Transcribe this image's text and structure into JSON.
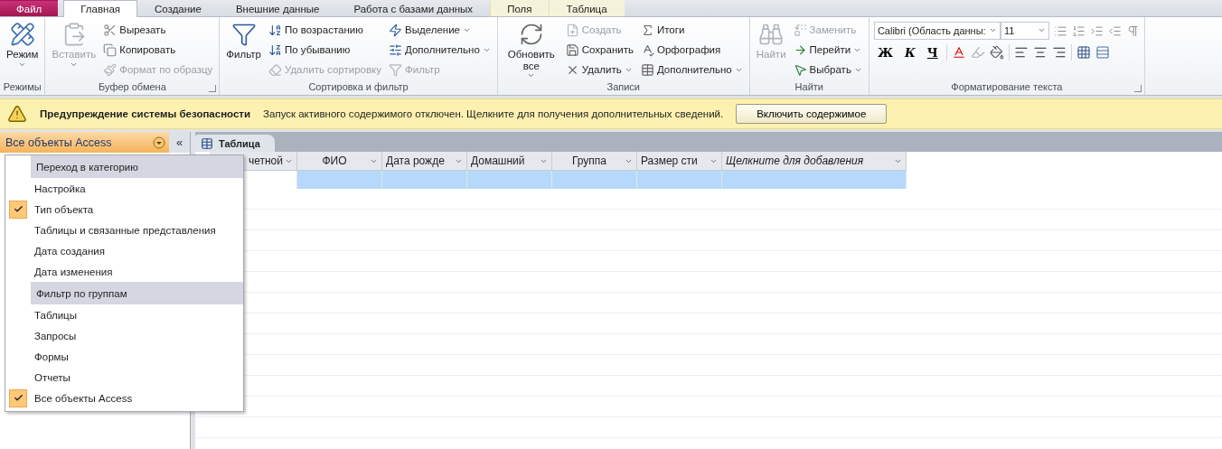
{
  "tabs": [
    {
      "label": "Файл",
      "kind": "file",
      "selected": false
    },
    {
      "label": "Главная",
      "kind": "normal",
      "selected": true
    },
    {
      "label": "Создание",
      "kind": "normal",
      "selected": false
    },
    {
      "label": "Внешние данные",
      "kind": "normal",
      "selected": false
    },
    {
      "label": "Работа с базами данных",
      "kind": "normal",
      "selected": false
    },
    {
      "label": "Поля",
      "kind": "context",
      "selected": false
    },
    {
      "label": "Таблица",
      "kind": "context",
      "selected": false
    }
  ],
  "ribbon": {
    "groups": [
      {
        "label": "Режимы",
        "launcher": false,
        "columns": [
          {
            "kind": "large",
            "label": "Режим",
            "disabled": false,
            "dropdown": true
          }
        ]
      },
      {
        "label": "Буфер обмена",
        "launcher": true,
        "columns": [
          {
            "kind": "large",
            "label": "Вставить",
            "disabled": true,
            "dropdown": true
          },
          {
            "kind": "stack",
            "items": [
              {
                "label": "Вырезать",
                "disabled": false,
                "dropdown": false
              },
              {
                "label": "Копировать",
                "disabled": false,
                "dropdown": false
              },
              {
                "label": "Формат по образцу",
                "disabled": true,
                "dropdown": false
              }
            ]
          }
        ]
      },
      {
        "label": "Сортировка и фильтр",
        "launcher": false,
        "columns": [
          {
            "kind": "large",
            "label": "Фильтр",
            "disabled": false,
            "dropdown": false
          },
          {
            "kind": "stack",
            "items": [
              {
                "label": "По возрастанию",
                "disabled": false,
                "dropdown": false
              },
              {
                "label": "По убыванию",
                "disabled": false,
                "dropdown": false
              },
              {
                "label": "Удалить сортировку",
                "disabled": true,
                "dropdown": false
              }
            ]
          },
          {
            "kind": "stack",
            "items": [
              {
                "label": "Выделение",
                "disabled": false,
                "dropdown": true
              },
              {
                "label": "Дополнительно",
                "disabled": false,
                "dropdown": true
              },
              {
                "label": "Фильтр",
                "disabled": true,
                "dropdown": false
              }
            ]
          }
        ]
      },
      {
        "label": "Записи",
        "launcher": false,
        "columns": [
          {
            "kind": "large",
            "label": "Обновить все",
            "disabled": false,
            "dropdown": true
          },
          {
            "kind": "stack",
            "items": [
              {
                "label": "Создать",
                "disabled": true,
                "dropdown": false
              },
              {
                "label": "Сохранить",
                "disabled": false,
                "dropdown": false
              },
              {
                "label": "Удалить",
                "disabled": false,
                "dropdown": true
              }
            ]
          },
          {
            "kind": "stack",
            "items": [
              {
                "label": "Итоги",
                "disabled": false,
                "dropdown": false
              },
              {
                "label": "Орфография",
                "disabled": false,
                "dropdown": false
              },
              {
                "label": "Дополнительно",
                "disabled": false,
                "dropdown": true
              }
            ]
          }
        ]
      },
      {
        "label": "Найти",
        "launcher": false,
        "columns": [
          {
            "kind": "large",
            "label": "Найти",
            "disabled": true,
            "dropdown": false
          },
          {
            "kind": "stack",
            "items": [
              {
                "label": "Заменить",
                "disabled": true,
                "dropdown": false
              },
              {
                "label": "Перейти",
                "disabled": false,
                "dropdown": true
              },
              {
                "label": "Выбрать",
                "disabled": false,
                "dropdown": true
              }
            ]
          }
        ]
      },
      {
        "label": "Форматирование текста",
        "launcher": true,
        "columns": [
          {
            "kind": "format",
            "font": "Calibri (Область данны:",
            "size": "11",
            "styles": [
              "Ж",
              "К",
              "Ч"
            ]
          }
        ]
      }
    ]
  },
  "security_bar": {
    "title": "Предупреждение системы безопасности",
    "message": "Запуск активного содержимого отключен. Щелкните для получения дополнительных сведений.",
    "button": "Включить содержимое"
  },
  "nav_pane": {
    "title": "Все объекты Access",
    "collapse": "«",
    "menu": [
      {
        "kind": "header",
        "label": "Переход в категорию"
      },
      {
        "kind": "item",
        "label": "Настройка",
        "checked": false
      },
      {
        "kind": "item",
        "label": "Тип объекта",
        "checked": true
      },
      {
        "kind": "item",
        "label": "Таблицы и связанные представления",
        "checked": false
      },
      {
        "kind": "item",
        "label": "Дата создания",
        "checked": false
      },
      {
        "kind": "item",
        "label": "Дата изменения",
        "checked": false
      },
      {
        "kind": "header",
        "label": "Фильтр по группам"
      },
      {
        "kind": "item",
        "label": "Таблицы",
        "checked": false
      },
      {
        "kind": "item",
        "label": "Запросы",
        "checked": false
      },
      {
        "kind": "item",
        "label": "Формы",
        "checked": false
      },
      {
        "kind": "item",
        "label": "Отчеты",
        "checked": false
      },
      {
        "kind": "item",
        "label": "Все объекты Access",
        "checked": true
      }
    ]
  },
  "document": {
    "tab": "Таблица",
    "columns": [
      {
        "label": "четной",
        "kind": "field"
      },
      {
        "label": "ФИО",
        "kind": "field"
      },
      {
        "label": "Дата рожде",
        "kind": "field"
      },
      {
        "label": "Домашний",
        "kind": "field"
      },
      {
        "label": "Группа",
        "kind": "field"
      },
      {
        "label": "Размер сти",
        "kind": "field"
      },
      {
        "label": "Щелкните для добавления",
        "kind": "add"
      }
    ]
  }
}
